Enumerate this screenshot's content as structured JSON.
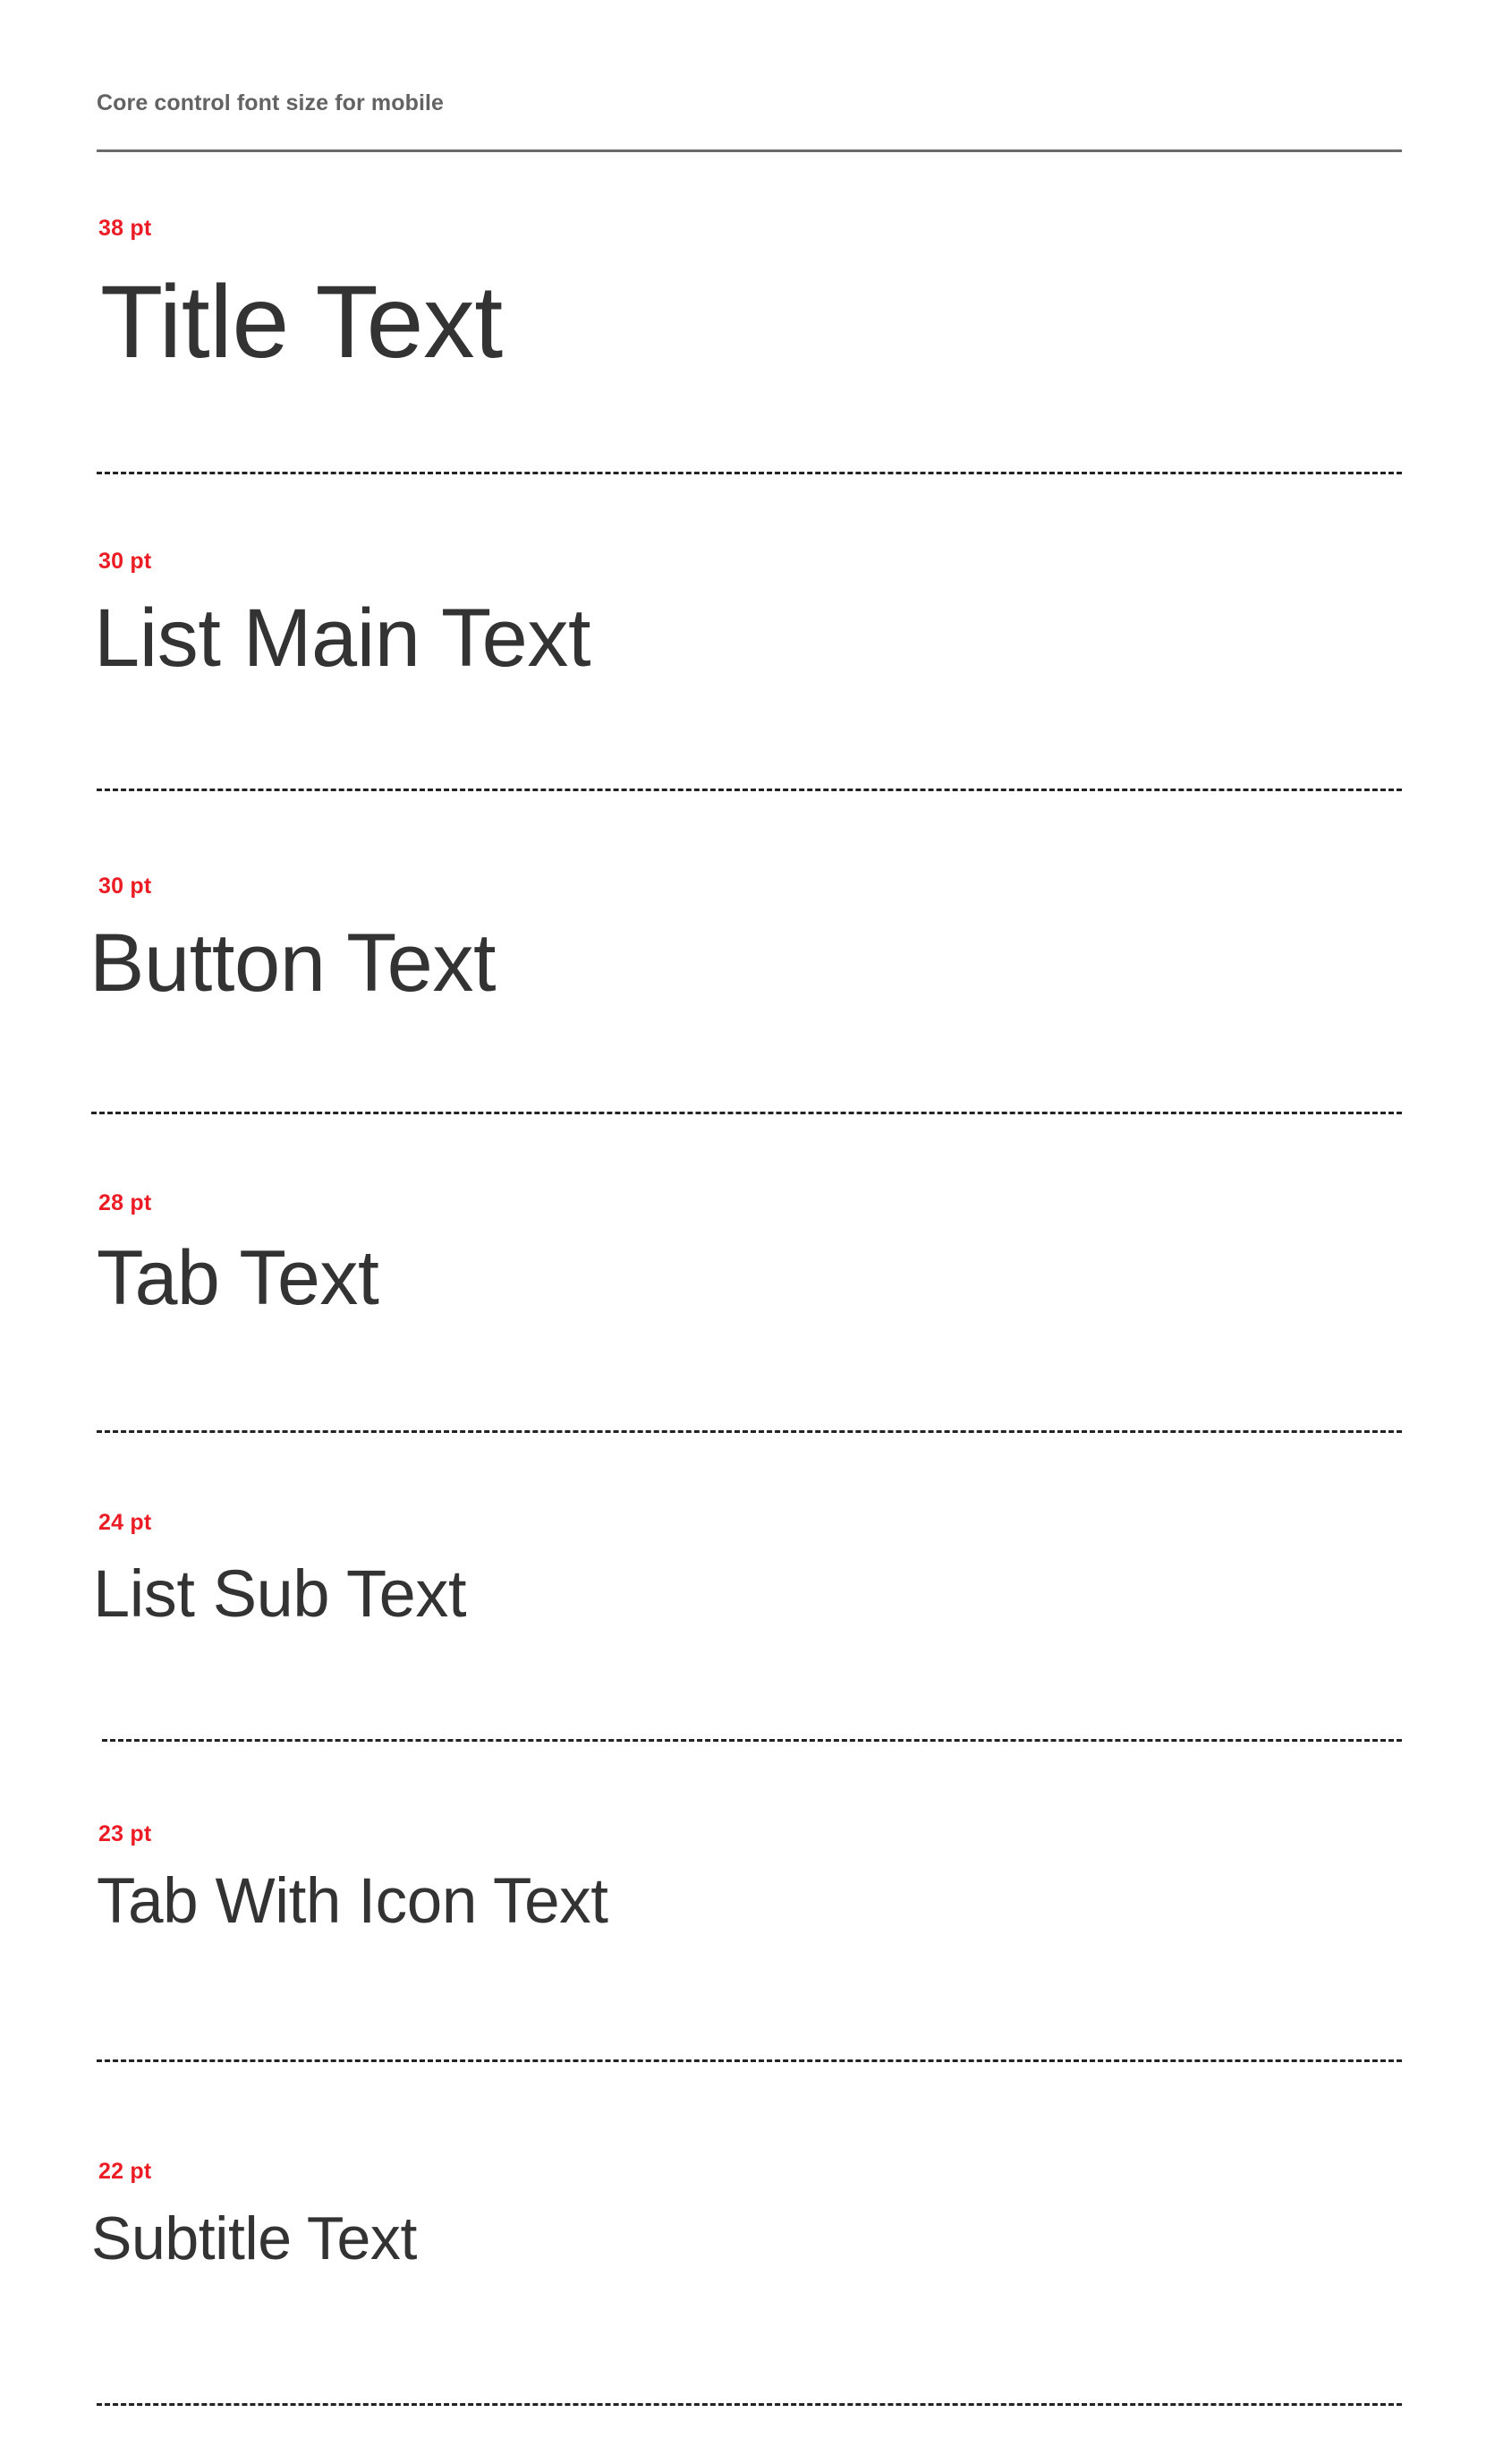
{
  "header": {
    "title": "Core control font size for mobile",
    "rule_color": "#6b6b6b",
    "title_color": "#636363"
  },
  "colors": {
    "accent_red": "#ec1c24",
    "sample_text": "#333333",
    "divider": "#232323",
    "background": "#ffffff"
  },
  "specs": [
    {
      "size_label": "38 pt",
      "sample": "Title Text"
    },
    {
      "size_label": "30 pt",
      "sample": "List Main Text"
    },
    {
      "size_label": "30 pt",
      "sample": "Button Text"
    },
    {
      "size_label": "28 pt",
      "sample": "Tab Text"
    },
    {
      "size_label": "24 pt",
      "sample": "List Sub Text"
    },
    {
      "size_label": "23 pt",
      "sample": "Tab With Icon Text"
    },
    {
      "size_label": "22 pt",
      "sample": "Subtitle Text"
    }
  ]
}
